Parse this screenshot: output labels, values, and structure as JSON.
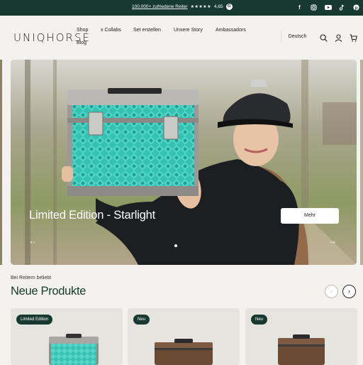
{
  "topbar": {
    "promo_link": "100.000+ zufriedene Reiter",
    "stars": "★★★★★",
    "rating": "4,65",
    "google_icon": "G",
    "socials": [
      "facebook-icon",
      "instagram-icon",
      "youtube-icon",
      "tiktok-icon",
      "pinterest-icon"
    ]
  },
  "header": {
    "logo": "UNIQHORSE",
    "nav": [
      "Shop",
      "x Collabs",
      "Set erstellen",
      "Unsere Story",
      "Ambassadors",
      "Blog"
    ],
    "language": "Deutsch",
    "icons": [
      "search-icon",
      "account-icon",
      "cart-icon"
    ]
  },
  "hero": {
    "title": "Limited Edition - Starlight",
    "button": "Mehr",
    "prev": "←",
    "next": "→"
  },
  "section": {
    "kicker": "Bei Reitern beliebt",
    "title": "Neue Produkte",
    "prev": "‹",
    "next": "›"
  },
  "products": [
    {
      "badge": "Limited Edition"
    },
    {
      "badge": "Neu"
    },
    {
      "badge": "Neu"
    }
  ],
  "colors": {
    "brand_green": "#17392f",
    "turquoise": "#2bb9ab",
    "brown_case": "#6b4a34"
  }
}
